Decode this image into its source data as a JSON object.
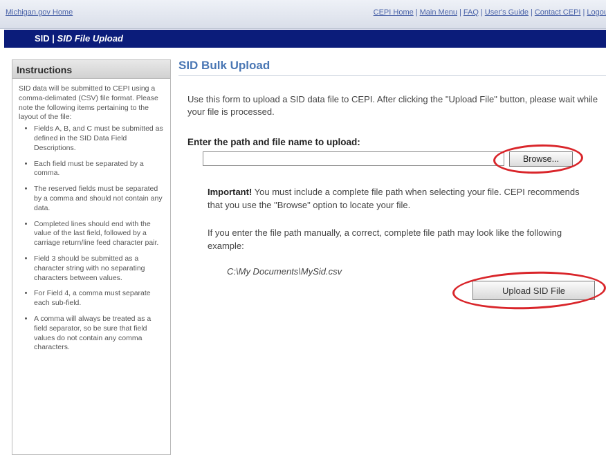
{
  "topbar": {
    "home_link": "Michigan.gov Home",
    "links": [
      "CEPI Home",
      "Main Menu",
      "FAQ",
      "User's Guide",
      "Contact CEPI",
      "Logout"
    ]
  },
  "titlebar": {
    "app": "SID |",
    "page": "SID File Upload"
  },
  "sidebar": {
    "heading": "Instructions",
    "intro": "SID data will be submitted to CEPI using a comma-delimated (CSV) file format. Please note the following items pertaining to the layout of the file:",
    "items": [
      "Fields A, B, and C must be submitted as defined in the SID Data Field Descriptions.",
      "Each field must be separated by a comma.",
      "The reserved fields must be separated by a comma and should not contain any data.",
      "Completed lines should end with the value of the last field, followed by a carriage return/line feed character pair.",
      "Field 3 should be submitted as a character string with no separating characters between values.",
      "For Field 4, a comma must separate each sub-field.",
      "A comma will always be treated as a field separator, so be sure that field values do not contain any comma characters."
    ]
  },
  "main": {
    "title": "SID Bulk Upload",
    "intro": "Use this form to upload a SID data file to CEPI. After clicking the \"Upload File\" button, please wait while your file is processed.",
    "path_label": "Enter the path and file name to upload:",
    "path_value": "",
    "browse_label": "Browse...",
    "important_label": "Important!",
    "important_text": " You must include a complete file path when selecting your file. CEPI recommends that you use the \"Browse\" option to locate your file.",
    "manual_text": "If you enter the file path manually, a correct, complete file path may look like the following example:",
    "example_path": "C:\\My Documents\\MySid.csv",
    "upload_label": "Upload SID File"
  },
  "colors": {
    "title_bar": "#0b1c7a",
    "link": "#4a63a8",
    "heading": "#4a77b4",
    "highlight_ring": "#d9252a"
  }
}
